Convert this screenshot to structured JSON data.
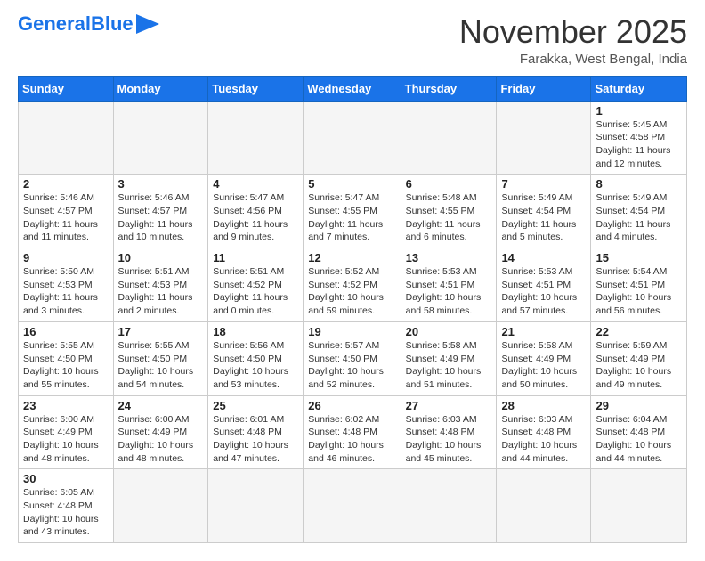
{
  "header": {
    "logo_general": "General",
    "logo_blue": "Blue",
    "month_title": "November 2025",
    "location": "Farakka, West Bengal, India"
  },
  "weekdays": [
    "Sunday",
    "Monday",
    "Tuesday",
    "Wednesday",
    "Thursday",
    "Friday",
    "Saturday"
  ],
  "weeks": [
    [
      {
        "day": "",
        "info": ""
      },
      {
        "day": "",
        "info": ""
      },
      {
        "day": "",
        "info": ""
      },
      {
        "day": "",
        "info": ""
      },
      {
        "day": "",
        "info": ""
      },
      {
        "day": "",
        "info": ""
      },
      {
        "day": "1",
        "info": "Sunrise: 5:45 AM\nSunset: 4:58 PM\nDaylight: 11 hours and 12 minutes."
      }
    ],
    [
      {
        "day": "2",
        "info": "Sunrise: 5:46 AM\nSunset: 4:57 PM\nDaylight: 11 hours and 11 minutes."
      },
      {
        "day": "3",
        "info": "Sunrise: 5:46 AM\nSunset: 4:57 PM\nDaylight: 11 hours and 10 minutes."
      },
      {
        "day": "4",
        "info": "Sunrise: 5:47 AM\nSunset: 4:56 PM\nDaylight: 11 hours and 9 minutes."
      },
      {
        "day": "5",
        "info": "Sunrise: 5:47 AM\nSunset: 4:55 PM\nDaylight: 11 hours and 7 minutes."
      },
      {
        "day": "6",
        "info": "Sunrise: 5:48 AM\nSunset: 4:55 PM\nDaylight: 11 hours and 6 minutes."
      },
      {
        "day": "7",
        "info": "Sunrise: 5:49 AM\nSunset: 4:54 PM\nDaylight: 11 hours and 5 minutes."
      },
      {
        "day": "8",
        "info": "Sunrise: 5:49 AM\nSunset: 4:54 PM\nDaylight: 11 hours and 4 minutes."
      }
    ],
    [
      {
        "day": "9",
        "info": "Sunrise: 5:50 AM\nSunset: 4:53 PM\nDaylight: 11 hours and 3 minutes."
      },
      {
        "day": "10",
        "info": "Sunrise: 5:51 AM\nSunset: 4:53 PM\nDaylight: 11 hours and 2 minutes."
      },
      {
        "day": "11",
        "info": "Sunrise: 5:51 AM\nSunset: 4:52 PM\nDaylight: 11 hours and 0 minutes."
      },
      {
        "day": "12",
        "info": "Sunrise: 5:52 AM\nSunset: 4:52 PM\nDaylight: 10 hours and 59 minutes."
      },
      {
        "day": "13",
        "info": "Sunrise: 5:53 AM\nSunset: 4:51 PM\nDaylight: 10 hours and 58 minutes."
      },
      {
        "day": "14",
        "info": "Sunrise: 5:53 AM\nSunset: 4:51 PM\nDaylight: 10 hours and 57 minutes."
      },
      {
        "day": "15",
        "info": "Sunrise: 5:54 AM\nSunset: 4:51 PM\nDaylight: 10 hours and 56 minutes."
      }
    ],
    [
      {
        "day": "16",
        "info": "Sunrise: 5:55 AM\nSunset: 4:50 PM\nDaylight: 10 hours and 55 minutes."
      },
      {
        "day": "17",
        "info": "Sunrise: 5:55 AM\nSunset: 4:50 PM\nDaylight: 10 hours and 54 minutes."
      },
      {
        "day": "18",
        "info": "Sunrise: 5:56 AM\nSunset: 4:50 PM\nDaylight: 10 hours and 53 minutes."
      },
      {
        "day": "19",
        "info": "Sunrise: 5:57 AM\nSunset: 4:50 PM\nDaylight: 10 hours and 52 minutes."
      },
      {
        "day": "20",
        "info": "Sunrise: 5:58 AM\nSunset: 4:49 PM\nDaylight: 10 hours and 51 minutes."
      },
      {
        "day": "21",
        "info": "Sunrise: 5:58 AM\nSunset: 4:49 PM\nDaylight: 10 hours and 50 minutes."
      },
      {
        "day": "22",
        "info": "Sunrise: 5:59 AM\nSunset: 4:49 PM\nDaylight: 10 hours and 49 minutes."
      }
    ],
    [
      {
        "day": "23",
        "info": "Sunrise: 6:00 AM\nSunset: 4:49 PM\nDaylight: 10 hours and 48 minutes."
      },
      {
        "day": "24",
        "info": "Sunrise: 6:00 AM\nSunset: 4:49 PM\nDaylight: 10 hours and 48 minutes."
      },
      {
        "day": "25",
        "info": "Sunrise: 6:01 AM\nSunset: 4:48 PM\nDaylight: 10 hours and 47 minutes."
      },
      {
        "day": "26",
        "info": "Sunrise: 6:02 AM\nSunset: 4:48 PM\nDaylight: 10 hours and 46 minutes."
      },
      {
        "day": "27",
        "info": "Sunrise: 6:03 AM\nSunset: 4:48 PM\nDaylight: 10 hours and 45 minutes."
      },
      {
        "day": "28",
        "info": "Sunrise: 6:03 AM\nSunset: 4:48 PM\nDaylight: 10 hours and 44 minutes."
      },
      {
        "day": "29",
        "info": "Sunrise: 6:04 AM\nSunset: 4:48 PM\nDaylight: 10 hours and 44 minutes."
      }
    ],
    [
      {
        "day": "30",
        "info": "Sunrise: 6:05 AM\nSunset: 4:48 PM\nDaylight: 10 hours and 43 minutes."
      },
      {
        "day": "",
        "info": ""
      },
      {
        "day": "",
        "info": ""
      },
      {
        "day": "",
        "info": ""
      },
      {
        "day": "",
        "info": ""
      },
      {
        "day": "",
        "info": ""
      },
      {
        "day": "",
        "info": ""
      }
    ]
  ]
}
